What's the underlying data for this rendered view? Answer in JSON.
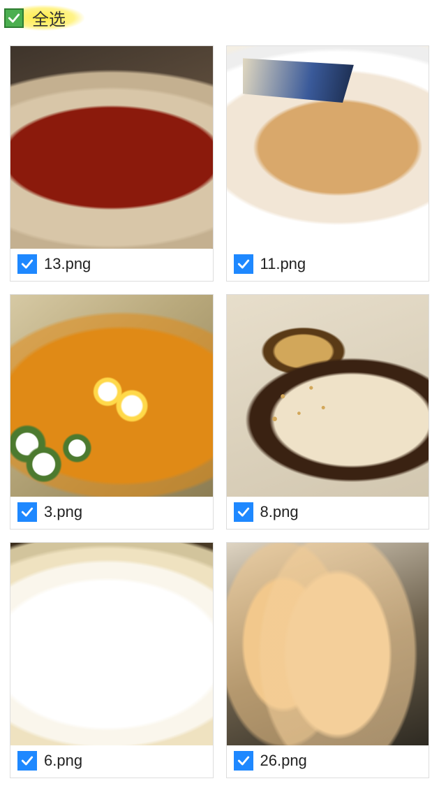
{
  "header": {
    "select_all_label": "全选",
    "select_all_checked": true
  },
  "items": [
    {
      "filename": "13.png",
      "checked": true
    },
    {
      "filename": "11.png",
      "checked": true
    },
    {
      "filename": "3.png",
      "checked": true
    },
    {
      "filename": "8.png",
      "checked": true
    },
    {
      "filename": "6.png",
      "checked": true
    },
    {
      "filename": "26.png",
      "checked": true
    }
  ],
  "colors": {
    "select_all_checkbox": "#4caf50",
    "item_checkbox": "#1e88ff",
    "highlight": "#ffeb3b"
  }
}
